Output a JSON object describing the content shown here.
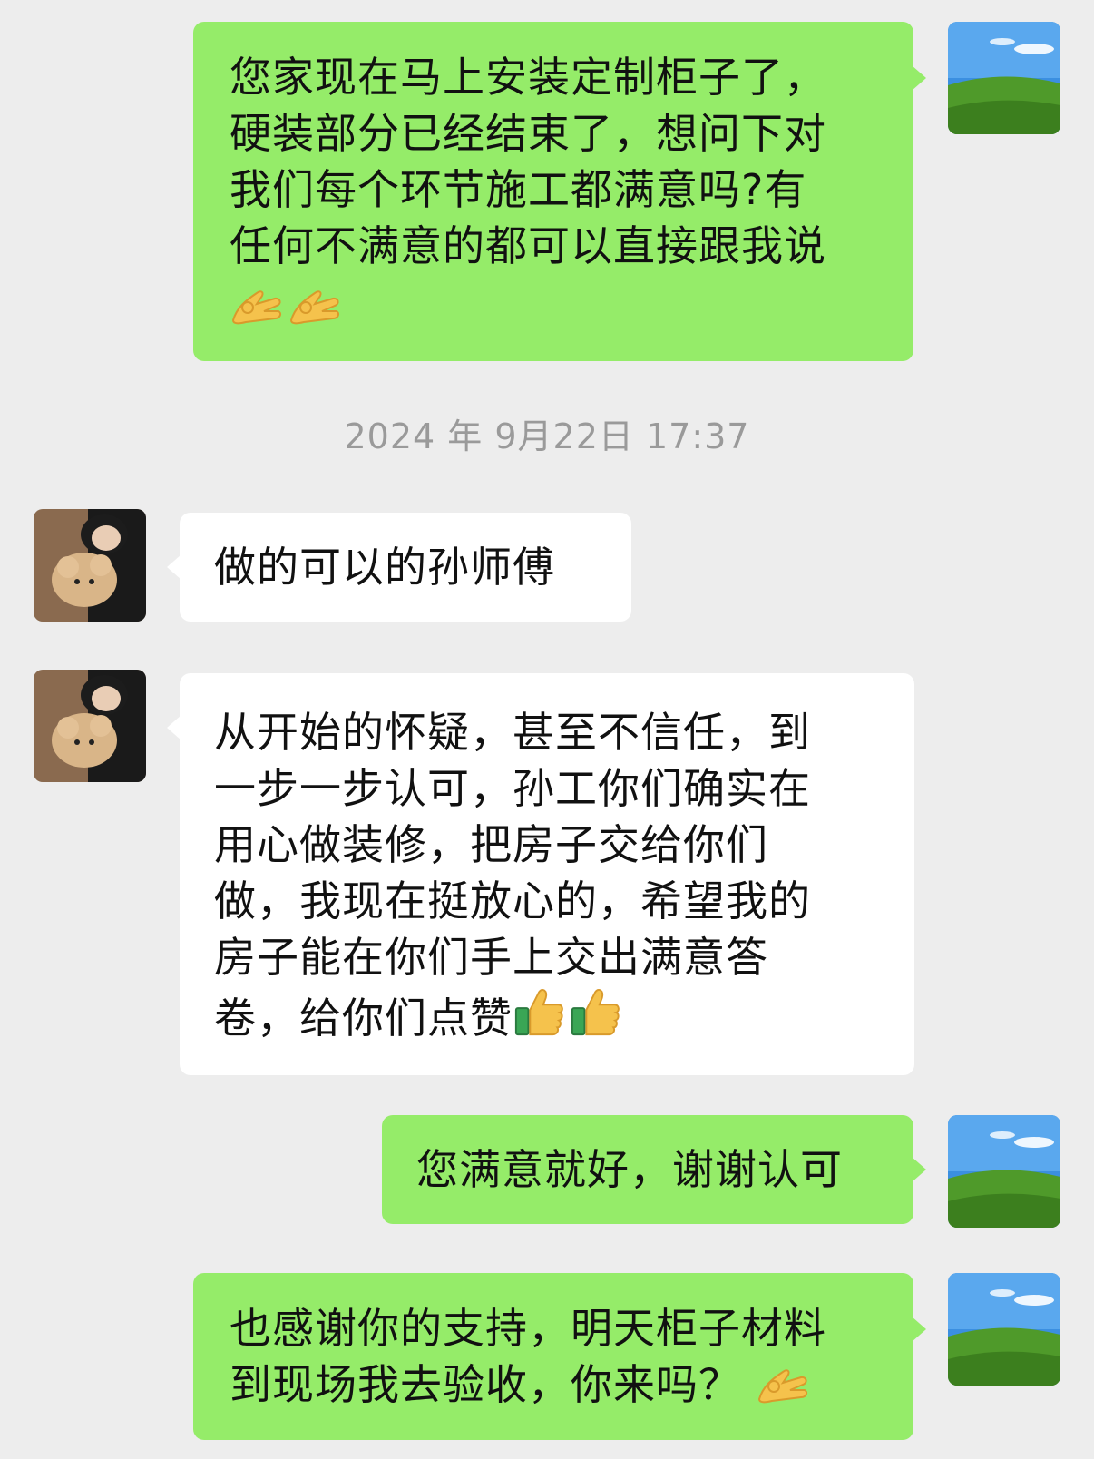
{
  "messages": [
    {
      "side": "out",
      "text": "您家现在马上安装定制柜子了，\n硬装部分已经结束了，想问下对\n我们每个环节施工都满意吗?有\n任何不满意的都可以直接跟我说",
      "emoji": [
        "ok-hand-icon",
        "ok-hand-icon"
      ]
    },
    {
      "side": "in",
      "text": "做的可以的孙师傅"
    },
    {
      "side": "in",
      "text": "从开始的怀疑，甚至不信任，到\n一步一步认可，孙工你们确实在\n用心做装修，把房子交给你们\n做，我现在挺放心的，希望我的\n房子能在你们手上交出满意答\n卷，给你们点赞",
      "emoji": [
        "thumbs-up-icon",
        "thumbs-up-icon"
      ]
    },
    {
      "side": "out",
      "text": "您满意就好，谢谢认可"
    },
    {
      "side": "out",
      "text": "也感谢你的支持，明天柜子材料\n到现场我去验收，你来吗？",
      "emoji": [
        "ok-hand-icon"
      ]
    }
  ],
  "timestamp": "2024 年 9月22日 17:37",
  "colors": {
    "background": "#ededed",
    "outgoing_bubble": "#95ec69",
    "incoming_bubble": "#ffffff",
    "timestamp_text": "#9a9a9a"
  }
}
